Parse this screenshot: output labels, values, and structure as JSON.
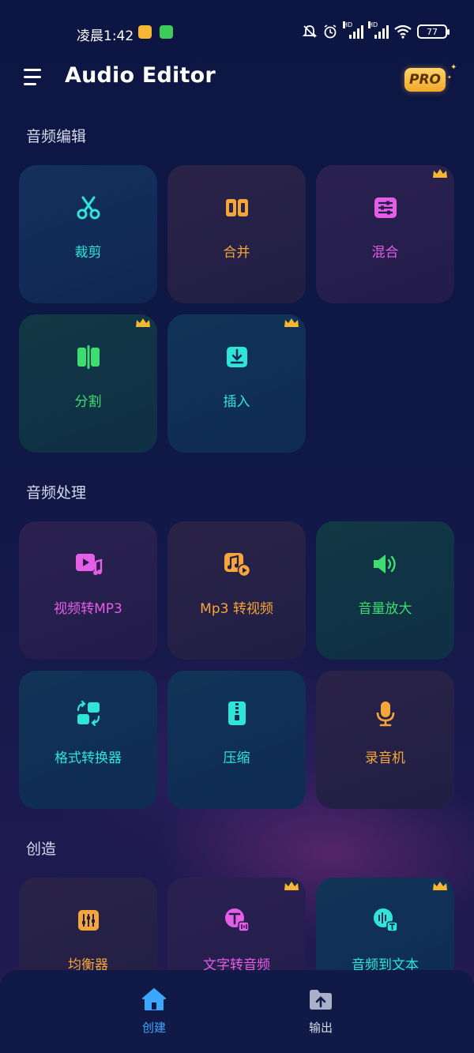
{
  "status": {
    "time": "凌晨1:42",
    "battery": "77",
    "hd1": "HD",
    "hd2": "HD"
  },
  "header": {
    "title": "Audio Editor",
    "pro_badge": "PRO"
  },
  "sections": {
    "edit": {
      "title": "音频编辑"
    },
    "process": {
      "title": "音频处理"
    },
    "create": {
      "title": "创造"
    }
  },
  "tiles": {
    "trim": {
      "label": "裁剪",
      "icon": "scissors-icon",
      "color": "#2ee6d6"
    },
    "merge": {
      "label": "合并",
      "icon": "merge-icon",
      "color": "#f5a63a"
    },
    "mix": {
      "label": "混合",
      "icon": "mix-icon",
      "color": "#e45ee6",
      "pro": true
    },
    "split": {
      "label": "分割",
      "icon": "split-icon",
      "color": "#3fdc70",
      "pro": true
    },
    "insert": {
      "label": "插入",
      "icon": "insert-icon",
      "color": "#2ee6d6",
      "pro": true
    },
    "video_to_mp3": {
      "label": "视频转MP3",
      "icon": "video-music-icon",
      "color": "#e45ee6"
    },
    "mp3_to_video": {
      "label": "Mp3 转视频",
      "icon": "music-video-icon",
      "color": "#f5a63a"
    },
    "volume_boost": {
      "label": "音量放大",
      "icon": "speaker-icon",
      "color": "#3fdc70"
    },
    "format_converter": {
      "label": "格式转换器",
      "icon": "convert-icon",
      "color": "#2ee6d6"
    },
    "compress": {
      "label": "压缩",
      "icon": "zip-icon",
      "color": "#2ee6d6"
    },
    "recorder": {
      "label": "录音机",
      "icon": "microphone-icon",
      "color": "#f5a63a"
    },
    "equalizer": {
      "label": "均衡器",
      "icon": "equalizer-icon",
      "color": "#f5a63a"
    },
    "text_to_audio": {
      "label": "文字转音频",
      "icon": "text-audio-icon",
      "color": "#e45ee6",
      "pro": true
    },
    "audio_to_text": {
      "label": "音频到文本",
      "icon": "audio-text-icon",
      "color": "#2ee6d6",
      "pro": true
    }
  },
  "nav": {
    "create": {
      "label": "创建",
      "color": "#3aa8ff"
    },
    "output": {
      "label": "输出",
      "color": "#d6d9ea"
    }
  }
}
